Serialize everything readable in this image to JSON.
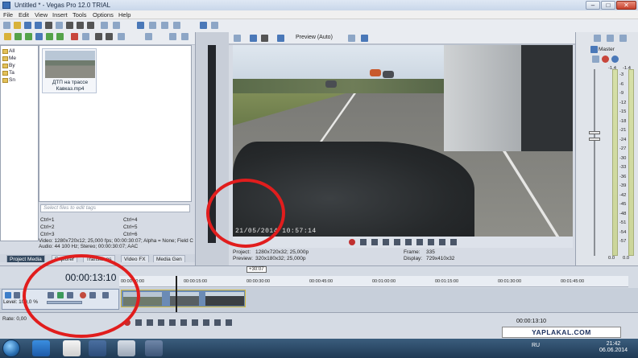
{
  "window": {
    "title": "Untitled * - Vegas Pro 12.0 TRIAL"
  },
  "menu": [
    "File",
    "Edit",
    "View",
    "Insert",
    "Tools",
    "Options",
    "Help"
  ],
  "tree": [
    "All",
    "Me",
    "By",
    "Ta",
    "Sn"
  ],
  "media": {
    "thumb_title": "ДТП на трассе Кавказ.mp4",
    "tag_placeholder": "Select files to edit tags",
    "shortcuts": [
      "Ctrl+1",
      "Ctrl+4",
      "Ctrl+2",
      "Ctrl+5",
      "Ctrl+3",
      "Ctrl+6"
    ],
    "info_line1": "Video: 1280x720x12; 25,000 fps; 00:00:30:07; Alpha = None; Field C",
    "info_line2": "Audio: 44 100 Hz; Stereo; 00:00:30:07; AAC"
  },
  "tabs": [
    "Project Media",
    "Explorer",
    "Transitions",
    "Video FX",
    "Media Gen"
  ],
  "preview": {
    "mode": "Preview (Auto)",
    "timestamp": "21/05/2014 10:57:14",
    "project_label": "Project:",
    "project_value": "1280x720x32; 25,000p",
    "preview_label": "Preview:",
    "preview_value": "320x180x32; 25,000p",
    "frame_label": "Frame:",
    "frame_value": "335",
    "display_label": "Display:",
    "display_value": "729x410x32"
  },
  "meter": {
    "title": "Master",
    "peak_left": "-1.4",
    "peak_right": "-1.4",
    "scale": [
      "3",
      "6",
      "9",
      "12",
      "15",
      "18",
      "21",
      "24",
      "27",
      "30",
      "33",
      "36",
      "39",
      "42",
      "45",
      "48",
      "51",
      "54",
      "57"
    ],
    "bottom_left": "0.0",
    "bottom_right": "0.0"
  },
  "timeline": {
    "timecode": "00:00:13:10",
    "marker": "+30:07",
    "ruler": [
      "00:00:00:00",
      "00:00:15:00",
      "00:00:30:00",
      "00:00:45:00",
      "00:01:00:00",
      "00:01:15:00",
      "00:01:30:00",
      "00:01:45:00"
    ],
    "level_label": "Level: 100,0 %",
    "rate_label": "Rate: 0,00",
    "bottom_time": "00:00:13:10"
  },
  "watermark": "YAPLAKAL.COM",
  "taskbar": {
    "language": "RU",
    "time": "21:42",
    "date": "06.06.2014"
  },
  "colors": {
    "annotation": "#e11d1d",
    "clip_border": "#d2b83a",
    "taskbar": "#1f3a55"
  }
}
